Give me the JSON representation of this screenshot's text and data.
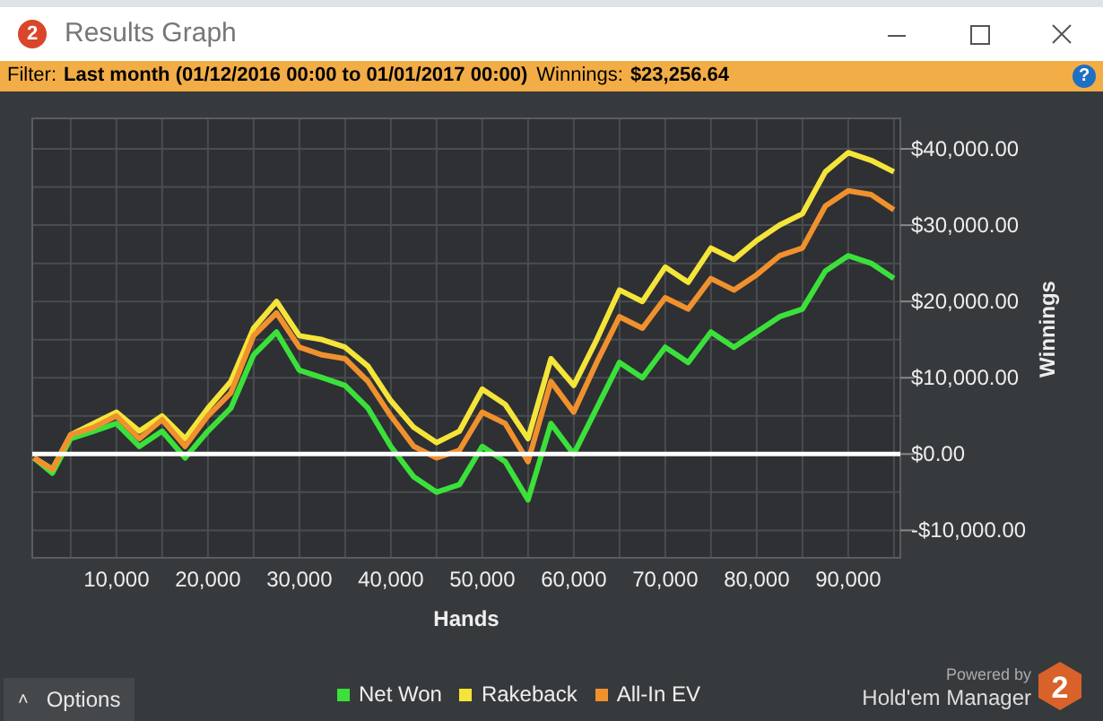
{
  "window": {
    "title": "Results Graph",
    "app_badge": "2"
  },
  "filter_bar": {
    "label": "Filter:",
    "filter": "Last month (01/12/2016 00:00 to 01/01/2017 00:00)",
    "winnings_label": "Winnings:",
    "winnings": "$23,256.64",
    "help": "?"
  },
  "chart_data": {
    "type": "line",
    "xlabel": "Hands",
    "ylabel": "Winnings",
    "grid": true,
    "xlim": [
      800,
      95700
    ],
    "ylim": [
      -13600,
      44000
    ],
    "xticks": [
      {
        "value": 10000,
        "label": "10,000"
      },
      {
        "value": 20000,
        "label": "20,000"
      },
      {
        "value": 30000,
        "label": "30,000"
      },
      {
        "value": 40000,
        "label": "40,000"
      },
      {
        "value": 50000,
        "label": "50,000"
      },
      {
        "value": 60000,
        "label": "60,000"
      },
      {
        "value": 70000,
        "label": "70,000"
      },
      {
        "value": 80000,
        "label": "80,000"
      },
      {
        "value": 90000,
        "label": "90,000"
      }
    ],
    "yticks": [
      {
        "value": 40000,
        "label": "$40,000.00"
      },
      {
        "value": 30000,
        "label": "$30,000.00"
      },
      {
        "value": 20000,
        "label": "$20,000.00"
      },
      {
        "value": 10000,
        "label": "$10,000.00"
      },
      {
        "value": 0,
        "label": "$0.00"
      },
      {
        "value": -10000,
        "label": "-$10,000.00"
      }
    ],
    "x": [
      1000,
      3000,
      5000,
      7500,
      10000,
      12500,
      15000,
      17500,
      20000,
      22500,
      25000,
      27500,
      30000,
      32500,
      35000,
      37500,
      40000,
      42500,
      45000,
      47500,
      50000,
      52500,
      55000,
      57500,
      60000,
      62500,
      65000,
      67500,
      70000,
      72500,
      75000,
      77500,
      80000,
      82500,
      85000,
      87500,
      90000,
      92500,
      95000
    ],
    "series": [
      {
        "name": "Net Won",
        "color": "#3be03b",
        "values": [
          -500,
          -2500,
          2000,
          3000,
          4000,
          1000,
          3000,
          -500,
          3000,
          6000,
          13000,
          16000,
          11000,
          10000,
          9000,
          6000,
          1000,
          -3000,
          -5000,
          -4000,
          1000,
          -1000,
          -6000,
          4000,
          0,
          6000,
          12000,
          10000,
          14000,
          12000,
          16000,
          14000,
          16000,
          18000,
          19000,
          24000,
          26000,
          25000,
          23000
        ]
      },
      {
        "name": "Rakeback",
        "color": "#f5e43a",
        "values": [
          -500,
          -2000,
          2500,
          4000,
          5500,
          3000,
          5000,
          2000,
          6000,
          9500,
          16500,
          20000,
          15500,
          15000,
          14000,
          11500,
          7000,
          3500,
          1500,
          3000,
          8500,
          6500,
          2000,
          12500,
          9000,
          15000,
          21500,
          20000,
          24500,
          22500,
          27000,
          25500,
          28000,
          30000,
          31500,
          37000,
          39500,
          38500,
          37000
        ]
      },
      {
        "name": "All-In EV",
        "color": "#f0912e",
        "values": [
          -500,
          -2000,
          2500,
          3500,
          5000,
          2000,
          4500,
          1000,
          5000,
          8000,
          15500,
          18500,
          14000,
          13000,
          12500,
          9500,
          5000,
          1000,
          -500,
          500,
          5500,
          4000,
          -1000,
          9500,
          5500,
          12000,
          18000,
          16500,
          20500,
          19000,
          23000,
          21500,
          23500,
          26000,
          27000,
          32500,
          34500,
          34000,
          32000
        ]
      }
    ]
  },
  "options_button": {
    "label": "Options",
    "caret": "˄"
  },
  "branding": {
    "powered_by": "Powered by",
    "product": "Hold'em Manager",
    "mark": "2"
  }
}
